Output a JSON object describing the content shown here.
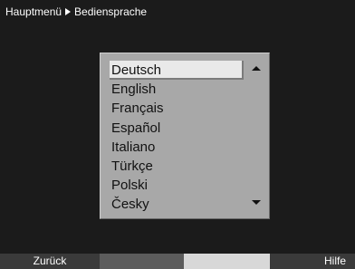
{
  "header": {
    "breadcrumb": [
      "Hauptmenü",
      "Bediensprache"
    ]
  },
  "language_list": {
    "items": [
      "Deutsch",
      "English",
      "Français",
      "Español",
      "Italiano",
      "Türkçe",
      "Polski",
      "Česky"
    ],
    "selected_index": 0,
    "scroll_up_icon": "arrow-up-icon",
    "scroll_down_icon": "arrow-down-icon"
  },
  "footer": {
    "buttons": [
      {
        "label": "Zurück",
        "color": "#3a3a3a"
      },
      {
        "label": "",
        "color": "#5c5c5c"
      },
      {
        "label": "",
        "color": "#d8d8d8"
      },
      {
        "label": "Hilfe",
        "color": "#3a3a3a"
      }
    ]
  },
  "colors": {
    "background": "#1b1b1b",
    "panel": "#a8a8a8",
    "highlight": "#e9e9e9"
  }
}
